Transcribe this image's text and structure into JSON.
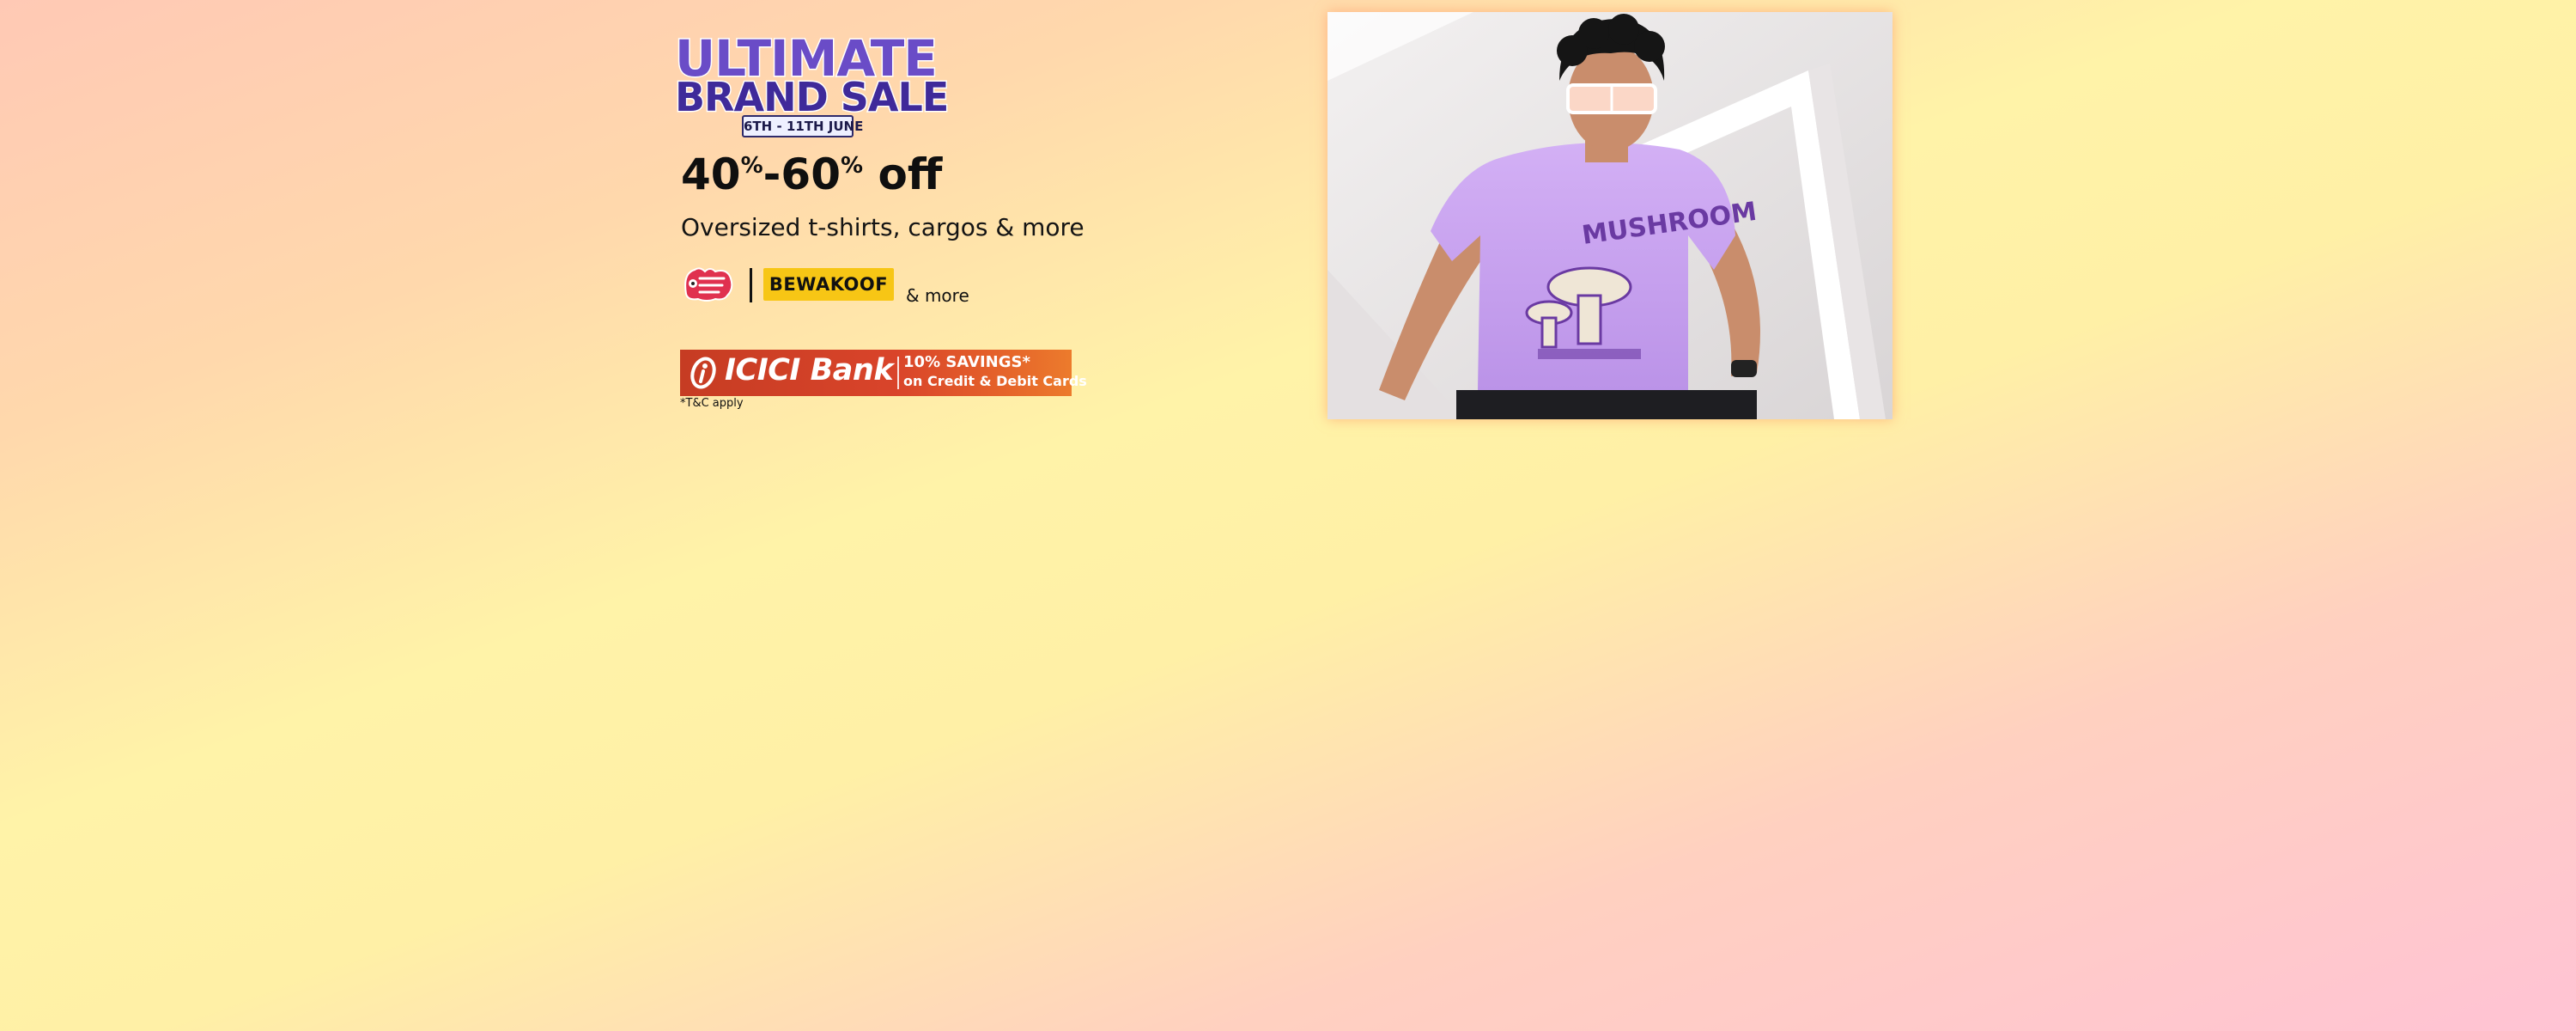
{
  "banner": {
    "logo": {
      "line1": "ULTIMATE",
      "line2": "BRAND SALE",
      "dates": "6TH - 11TH JUNE"
    },
    "discount": {
      "from_value": "40",
      "to_value": "60",
      "percent_sign": "%",
      "dash": "-",
      "suffix": "off"
    },
    "subheadline": "Oversized t-shirts, cargos & more",
    "brands": {
      "items": [
        {
          "name": "The Souled Store",
          "icon": "souled-store-logo"
        },
        {
          "name": "BEWAKOOF",
          "icon": "bewakoof-logo"
        }
      ],
      "more_text": "& more"
    },
    "bank_offer": {
      "bank_name": "ICICI Bank",
      "savings_value": "10",
      "savings_suffix": "% SAVINGS*",
      "savings_line2": "on Credit & Debit Cards",
      "tnc": "*T&C apply"
    },
    "photo": {
      "icon": "model-photo",
      "tshirt_print_text": "MUSHROOM"
    }
  },
  "colors": {
    "logo_purple": "#4b2fa8",
    "bewakoof_yellow": "#f7c615",
    "icici_red": "#c63c23",
    "icici_orange": "#ec7b2c",
    "tshirt_lavender": "#c9a3f0"
  }
}
